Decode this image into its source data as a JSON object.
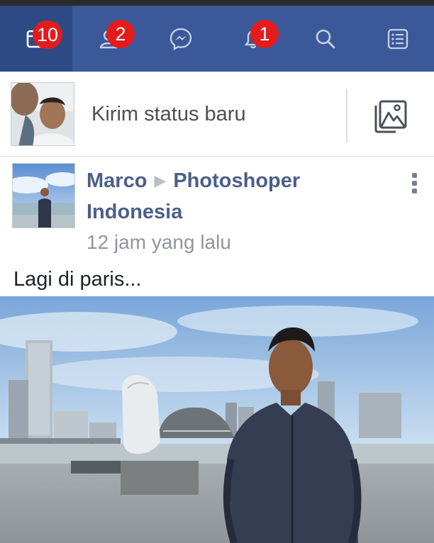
{
  "navbar": {
    "tabs": [
      {
        "icon": "news-feed-icon",
        "badge": "10",
        "active": true
      },
      {
        "icon": "friend-requests-icon",
        "badge": "2"
      },
      {
        "icon": "messenger-icon",
        "badge": ""
      },
      {
        "icon": "notifications-icon",
        "badge": "1"
      },
      {
        "icon": "search-icon",
        "badge": ""
      },
      {
        "icon": "menu-icon",
        "badge": ""
      }
    ],
    "colors": {
      "bar": "#3b5998",
      "active": "#2d4a85",
      "badge": "#e41b1b"
    }
  },
  "composer": {
    "placeholder": "Kirim status baru",
    "photo_icon": "photo-icon"
  },
  "post": {
    "author": "Marco",
    "group": "Photoshoper Indonesia",
    "timestamp": "12 jam yang lalu",
    "caption": "Lagi di paris..."
  }
}
